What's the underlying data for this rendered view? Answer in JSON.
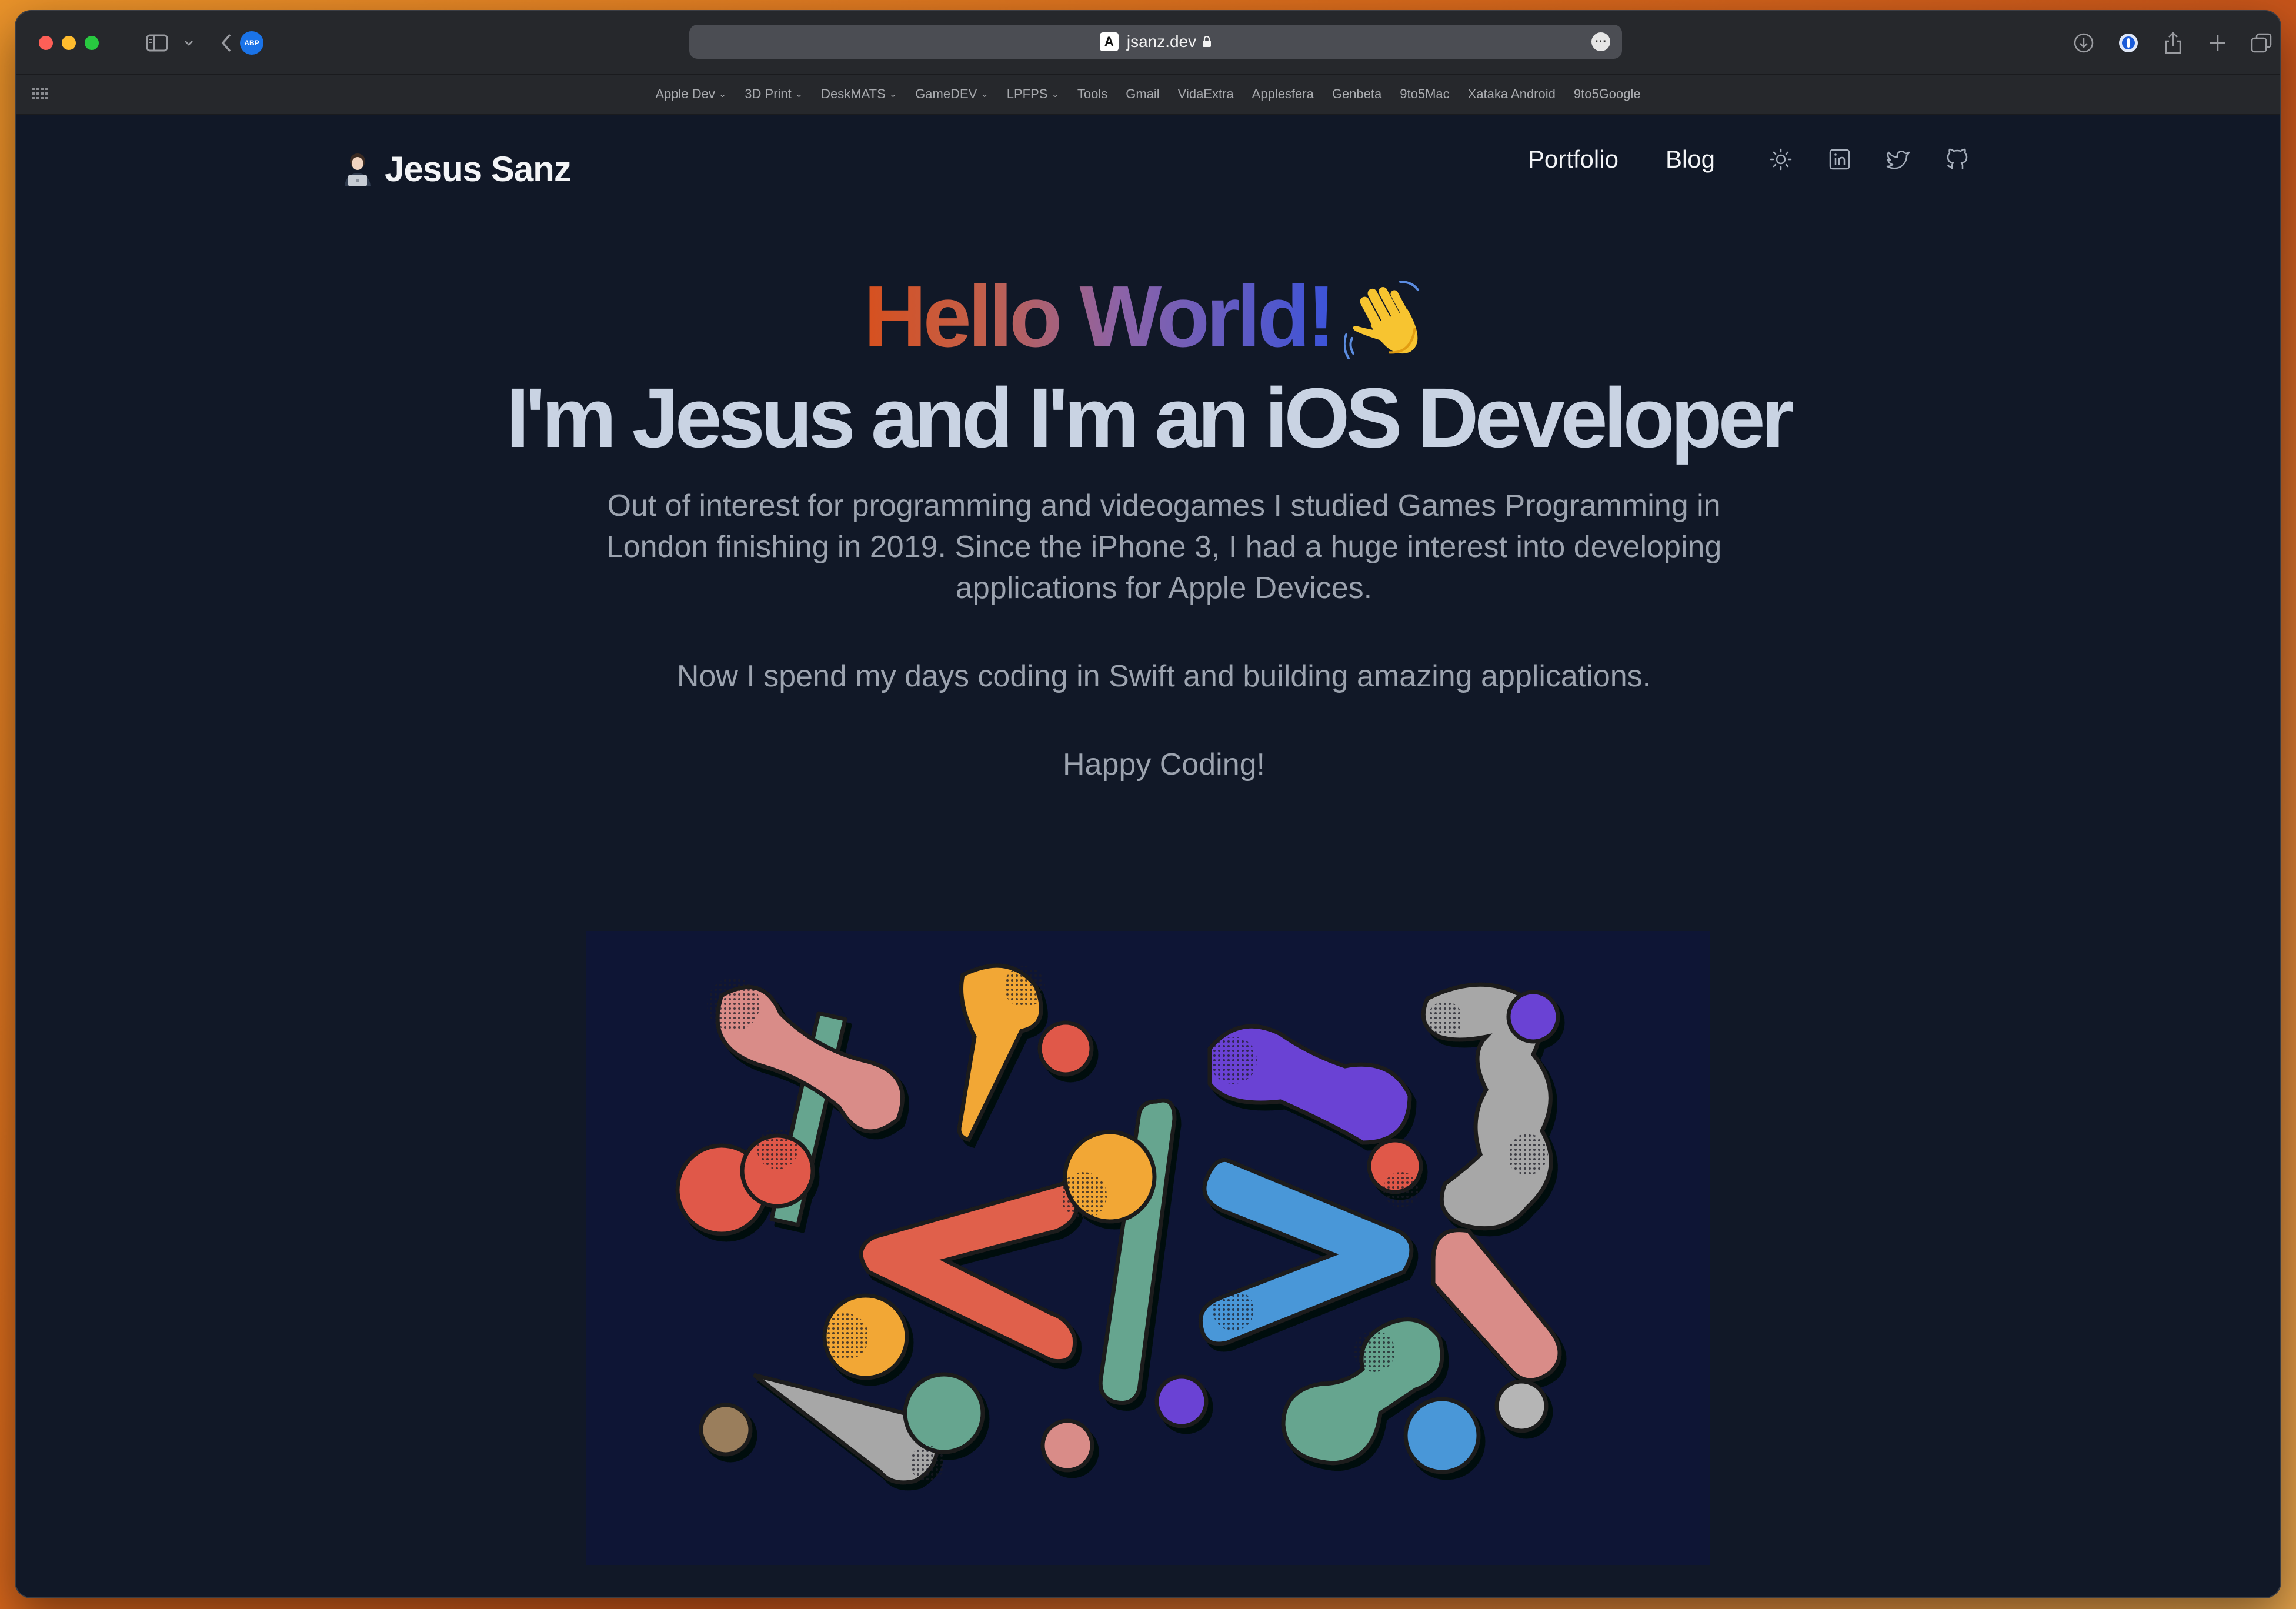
{
  "browser": {
    "url": "jsanz.dev",
    "favicon_letter": "A",
    "extension_badge": "ABP",
    "favorites": [
      {
        "label": "Apple Dev",
        "folder": true
      },
      {
        "label": "3D Print",
        "folder": true
      },
      {
        "label": "DeskMATS",
        "folder": true
      },
      {
        "label": "GameDEV",
        "folder": true
      },
      {
        "label": "LPFPS",
        "folder": true
      },
      {
        "label": "Tools",
        "folder": false
      },
      {
        "label": "Gmail",
        "folder": false
      },
      {
        "label": "VidaExtra",
        "folder": false
      },
      {
        "label": "Applesfera",
        "folder": false
      },
      {
        "label": "Genbeta",
        "folder": false
      },
      {
        "label": "9to5Mac",
        "folder": false
      },
      {
        "label": "Xataka Android",
        "folder": false
      },
      {
        "label": "9to5Google",
        "folder": false
      }
    ]
  },
  "site": {
    "brand_name": "Jesus Sanz",
    "nav": {
      "portfolio": "Portfolio",
      "blog": "Blog"
    },
    "icons": [
      "sun-icon",
      "linkedin-icon",
      "twitter-icon",
      "github-icon"
    ]
  },
  "hero": {
    "greeting": "Hello World!",
    "headline": "I'm Jesus and I'm an iOS Developer",
    "paragraph1": "Out of interest for programming and videogames I studied Games Programming in London finishing in 2019. Since the iPhone 3, I had a huge interest into developing applications for Apple Devices.",
    "paragraph2": "Now I spend my days coding in Swift and building amazing applications.",
    "paragraph3": "Happy Coding!"
  },
  "colors": {
    "page_bg": "#111827",
    "illustration_bg": "#0e1535",
    "gradient": [
      "#d7501e",
      "#8c63a8",
      "#3b53d9"
    ]
  }
}
